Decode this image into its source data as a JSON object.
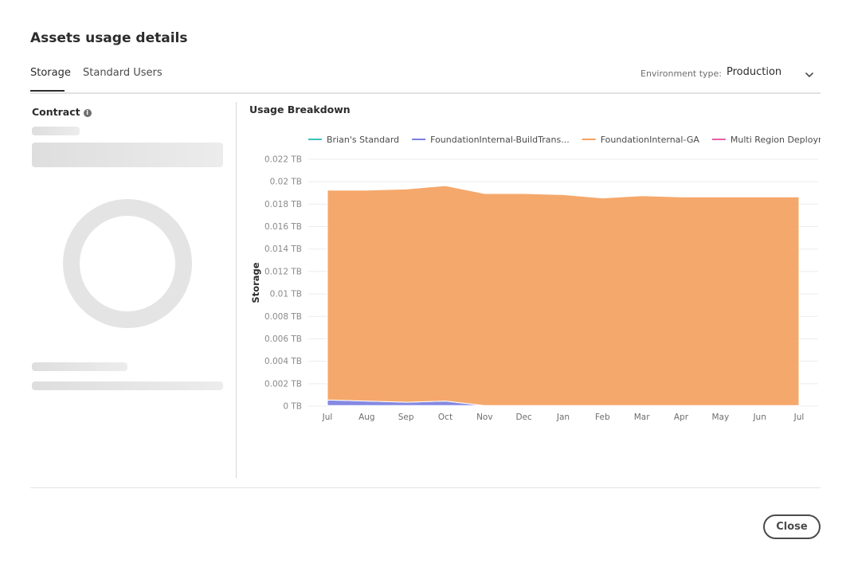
{
  "dialog": {
    "title": "Assets usage details",
    "close_label": "Close"
  },
  "tabs": [
    {
      "label": "Storage",
      "active": true
    },
    {
      "label": "Standard Users",
      "active": false
    }
  ],
  "environment": {
    "label": "Environment type:",
    "value": "Production",
    "icon": "chevron-down-icon"
  },
  "contract": {
    "title": "Contract",
    "info_icon": "info-icon"
  },
  "usage": {
    "title": "Usage Breakdown"
  },
  "colors": {
    "brians_standard": "#3cc2bd",
    "build_trans": "#7b7fe0",
    "ga": "#f4a15e",
    "multi_region": "#e85fa8",
    "grid": "#ececec",
    "axis_text": "#8a8a8a"
  },
  "chart_data": {
    "type": "area",
    "stacked": true,
    "xlabel": "",
    "ylabel": "Storage",
    "y_unit": "TB",
    "ylim": [
      0,
      0.022
    ],
    "yticks": [
      "0 TB",
      "0.002 TB",
      "0.004 TB",
      "0.006 TB",
      "0.008 TB",
      "0.01 TB",
      "0.012 TB",
      "0.014 TB",
      "0.016 TB",
      "0.018 TB",
      "0.02 TB",
      "0.022 TB"
    ],
    "categories": [
      "Jul",
      "Aug",
      "Sep",
      "Oct",
      "Nov",
      "Dec",
      "Jan",
      "Feb",
      "Mar",
      "Apr",
      "May",
      "Jun",
      "Jul"
    ],
    "legend_position": "top",
    "series": [
      {
        "name": "Brian's Standard",
        "color_key": "brians_standard",
        "values": [
          5e-05,
          5e-05,
          5e-05,
          5e-05,
          5e-05,
          5e-05,
          5e-05,
          5e-05,
          5e-05,
          5e-05,
          5e-05,
          5e-05,
          5e-05
        ]
      },
      {
        "name": "FoundationInternal-BuildTrans...",
        "color_key": "build_trans",
        "values": [
          0.0005,
          0.0004,
          0.0003,
          0.0004,
          0,
          0,
          0,
          0,
          0,
          0,
          0,
          0,
          0
        ]
      },
      {
        "name": "FoundationInternal-GA",
        "color_key": "ga",
        "values": [
          0.0187,
          0.0188,
          0.019,
          0.0192,
          0.0189,
          0.0189,
          0.0188,
          0.0185,
          0.0187,
          0.0186,
          0.0186,
          0.0186,
          0.0186
        ]
      },
      {
        "name": "Multi Region Deployment Demo",
        "color_key": "multi_region",
        "values": [
          0,
          0,
          0,
          0,
          0,
          0,
          0,
          0,
          0,
          0,
          0,
          0,
          0
        ]
      }
    ]
  }
}
